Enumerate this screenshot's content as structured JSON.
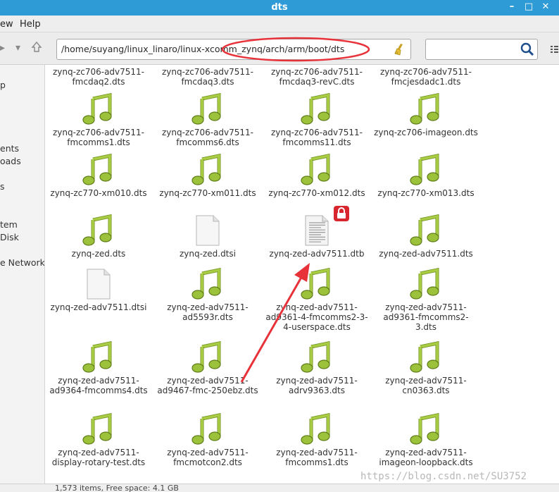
{
  "window": {
    "title": "dts"
  },
  "menu": {
    "view_label": "ew",
    "help_label": "Help"
  },
  "location": {
    "path": "/home/suyang/linux_linaro/linux-xcomm_zynq/arch/arm/boot/dts"
  },
  "search": {
    "placeholder": ""
  },
  "sidebar": {
    "items": [
      {
        "label": "p"
      },
      {
        "label": "ents"
      },
      {
        "label": "oads"
      },
      {
        "label": "s"
      },
      {
        "label": "tem"
      },
      {
        "label": " Disk"
      },
      {
        "label": "e Network"
      }
    ]
  },
  "files": [
    {
      "name": "zynq-zc706-adv7511-fmcdaq2.dts",
      "type": "audio"
    },
    {
      "name": "zynq-zc706-adv7511-fmcdaq3.dts",
      "type": "audio"
    },
    {
      "name": "zynq-zc706-adv7511-fmcdaq3-revC.dts",
      "type": "audio"
    },
    {
      "name": "zynq-zc706-adv7511-fmcjesdadc1.dts",
      "type": "audio"
    },
    {
      "name": "zynq-zc706-adv7511-fmcomms1.dts",
      "type": "audio"
    },
    {
      "name": "zynq-zc706-adv7511-fmcomms6.dts",
      "type": "audio"
    },
    {
      "name": "zynq-zc706-adv7511-fmcomms11.dts",
      "type": "audio"
    },
    {
      "name": "zynq-zc706-imageon.dts",
      "type": "audio"
    },
    {
      "name": "zynq-zc770-xm010.dts",
      "type": "audio"
    },
    {
      "name": "zynq-zc770-xm011.dts",
      "type": "audio"
    },
    {
      "name": "zynq-zc770-xm012.dts",
      "type": "audio"
    },
    {
      "name": "zynq-zc770-xm013.dts",
      "type": "audio"
    },
    {
      "name": "zynq-zed.dts",
      "type": "audio"
    },
    {
      "name": "zynq-zed.dtsi",
      "type": "blank"
    },
    {
      "name": "zynq-zed-adv7511.dtb",
      "type": "text-locked"
    },
    {
      "name": "zynq-zed-adv7511.dts",
      "type": "audio"
    },
    {
      "name": "zynq-zed-adv7511.dtsi",
      "type": "blank"
    },
    {
      "name": "zynq-zed-adv7511-ad5593r.dts",
      "type": "audio"
    },
    {
      "name": "zynq-zed-adv7511-ad9361-4-fmcomms2-3-4-userspace.dts",
      "type": "audio"
    },
    {
      "name": "zynq-zed-adv7511-ad9361-fmcomms2-3.dts",
      "type": "audio"
    },
    {
      "name": "zynq-zed-adv7511-ad9364-fmcomms4.dts",
      "type": "audio"
    },
    {
      "name": "zynq-zed-adv7511-ad9467-fmc-250ebz.dts",
      "type": "audio"
    },
    {
      "name": "zynq-zed-adv7511-adrv9363.dts",
      "type": "audio"
    },
    {
      "name": "zynq-zed-adv7511-cn0363.dts",
      "type": "audio"
    },
    {
      "name": "zynq-zed-adv7511-display-rotary-test.dts",
      "type": "audio"
    },
    {
      "name": "zynq-zed-adv7511-fmcmotcon2.dts",
      "type": "audio"
    },
    {
      "name": "zynq-zed-adv7511-fmcomms1.dts",
      "type": "audio"
    },
    {
      "name": "zynq-zed-adv7511-imageon-loopback.dts",
      "type": "audio"
    }
  ],
  "status": {
    "text": "1,573 items, Free space: 4.1 GB"
  },
  "watermark": {
    "text": "https://blog.csdn.net/SU3752"
  },
  "colors": {
    "titlebar": "#2f9bd6",
    "annotation": "#e8323a",
    "music_icon": "#9cc23c",
    "lock_badge": "#d7262e"
  }
}
